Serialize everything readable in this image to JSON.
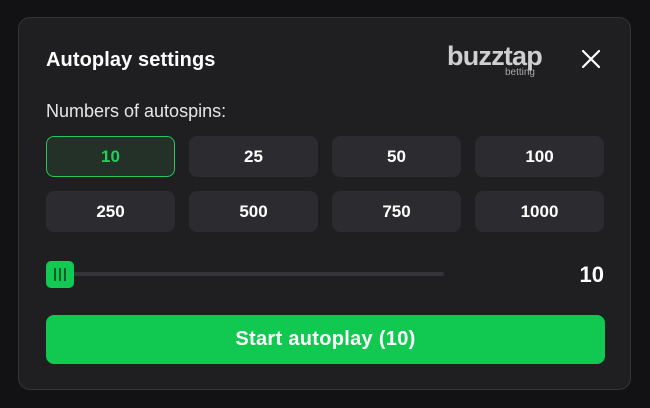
{
  "dialog": {
    "title": "Autoplay settings",
    "brand": {
      "name": "buzztap",
      "tagline": "betting"
    },
    "close_icon": "close-icon"
  },
  "autospins": {
    "label": "Numbers of autospins:",
    "options": [
      "10",
      "25",
      "50",
      "100",
      "250",
      "500",
      "750",
      "1000"
    ],
    "selected": "10"
  },
  "slider": {
    "value": "10",
    "level": 0
  },
  "start_button": {
    "label": "Start autoplay (10)"
  },
  "colors": {
    "accent": "#11c951",
    "panel": "#1f1f22",
    "option": "#2c2c30"
  }
}
